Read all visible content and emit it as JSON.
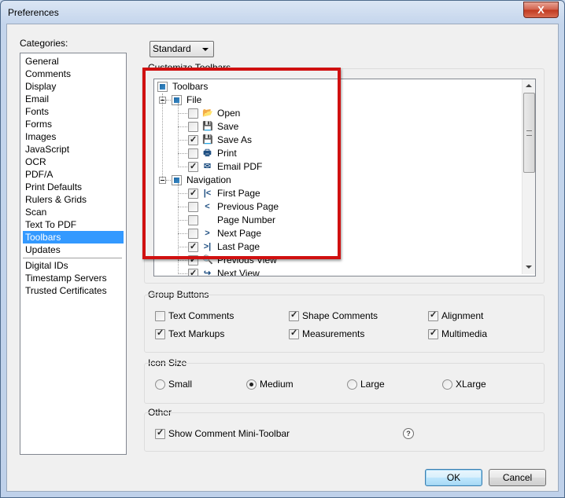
{
  "window": {
    "title": "Preferences",
    "close_label": "X"
  },
  "categories": {
    "label": "Categories:",
    "items": [
      "General",
      "Comments",
      "Display",
      "Email",
      "Fonts",
      "Forms",
      "Images",
      "JavaScript",
      "OCR",
      "PDF/A",
      "Print Defaults",
      "Rulers & Grids",
      "Scan",
      "Text To PDF",
      "Toolbars",
      "Updates"
    ],
    "selected": "Toolbars",
    "extra_items": [
      "Digital IDs",
      "Timestamp Servers",
      "Trusted Certificates"
    ]
  },
  "mode_select": {
    "value": "Standard"
  },
  "customize": {
    "label": "Customize Toolbars",
    "root": "Toolbars",
    "groups": [
      {
        "name": "File",
        "items": [
          {
            "label": "Open",
            "checked": false
          },
          {
            "label": "Save",
            "checked": false
          },
          {
            "label": "Save As",
            "checked": true
          },
          {
            "label": "Print",
            "checked": false
          },
          {
            "label": "Email PDF",
            "checked": true
          }
        ]
      },
      {
        "name": "Navigation",
        "items": [
          {
            "label": "First Page",
            "checked": true
          },
          {
            "label": "Previous Page",
            "checked": false
          },
          {
            "label": "Page Number",
            "checked": false
          },
          {
            "label": "Next Page",
            "checked": false
          },
          {
            "label": "Last Page",
            "checked": true
          },
          {
            "label": "Previous View",
            "checked": true
          },
          {
            "label": "Next View",
            "checked": true
          }
        ]
      }
    ]
  },
  "group_buttons": {
    "label": "Group Buttons",
    "options": [
      {
        "label": "Text Comments",
        "checked": false
      },
      {
        "label": "Shape Comments",
        "checked": true
      },
      {
        "label": "Alignment",
        "checked": true
      },
      {
        "label": "Text Markups",
        "checked": true
      },
      {
        "label": "Measurements",
        "checked": true
      },
      {
        "label": "Multimedia",
        "checked": true
      }
    ]
  },
  "icon_size": {
    "label": "Icon Size",
    "options": [
      "Small",
      "Medium",
      "Large",
      "XLarge"
    ],
    "selected": "Medium"
  },
  "other": {
    "label": "Other",
    "show_mini_toolbar": "Show Comment Mini-Toolbar",
    "show_mini_toolbar_checked": true,
    "help": "?"
  },
  "buttons": {
    "ok": "OK",
    "cancel": "Cancel"
  }
}
